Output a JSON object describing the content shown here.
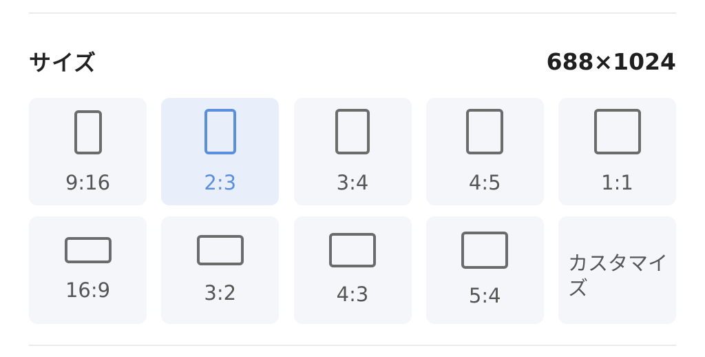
{
  "section": {
    "title": "サイズ",
    "current_size": "688×1024"
  },
  "ratios": [
    {
      "label": "9:16",
      "selected": false
    },
    {
      "label": "2:3",
      "selected": true
    },
    {
      "label": "3:4",
      "selected": false
    },
    {
      "label": "4:5",
      "selected": false
    },
    {
      "label": "1:1",
      "selected": false
    },
    {
      "label": "16:9",
      "selected": false
    },
    {
      "label": "3:2",
      "selected": false
    },
    {
      "label": "4:3",
      "selected": false
    },
    {
      "label": "5:4",
      "selected": false
    },
    {
      "label": "カスタマイズ",
      "selected": false
    }
  ],
  "colors": {
    "accent": "#5b8fde",
    "tile_bg": "#f5f6f9",
    "tile_selected_bg": "#e8effb",
    "icon": "#6b6b6b"
  }
}
